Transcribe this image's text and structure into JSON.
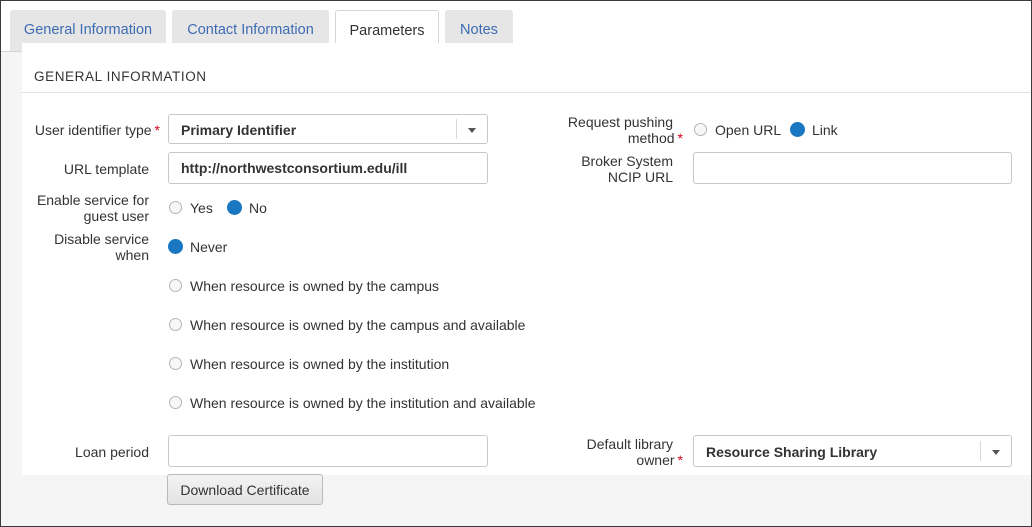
{
  "tabs": [
    {
      "label": "General Information",
      "active": false
    },
    {
      "label": "Contact Information",
      "active": false
    },
    {
      "label": "Parameters",
      "active": true
    },
    {
      "label": "Notes",
      "active": false
    }
  ],
  "section": {
    "title": "GENERAL INFORMATION"
  },
  "fields": {
    "user_identifier_type": {
      "label": "User identifier type",
      "required": "*",
      "value": "Primary Identifier"
    },
    "url_template": {
      "label": "URL template",
      "value": "http://northwestconsortium.edu/ill"
    },
    "enable_service_guest": {
      "label_line1": "Enable service for",
      "label_line2": "guest user",
      "options": [
        "Yes",
        "No"
      ],
      "selected": "No"
    },
    "disable_service_when": {
      "label_line1": "Disable service",
      "label_line2": "when",
      "options": [
        "Never",
        "When resource is owned by the campus",
        "When resource is owned by the campus and available",
        "When resource is owned by the institution",
        "When resource is owned by the institution and available"
      ],
      "selected": "Never"
    },
    "request_pushing_method": {
      "label_line1": "Request pushing",
      "label_line2": "method",
      "required": "*",
      "options": [
        "Open URL",
        "Link"
      ],
      "selected": "Link"
    },
    "broker_system_ncip_url": {
      "label_line1": "Broker System",
      "label_line2": "NCIP URL",
      "value": ""
    },
    "loan_period": {
      "label": "Loan period",
      "value": ""
    },
    "default_library_owner": {
      "label_line1": "Default library",
      "label_line2": "owner",
      "required": "*",
      "value": "Resource Sharing Library"
    }
  },
  "buttons": {
    "download_certificate": "Download Certificate"
  },
  "colors": {
    "tab_link": "#3d6cb3",
    "radio_selected": "#1a78c2",
    "required": "#d0021b",
    "content_bg": "#f5f5f5"
  }
}
